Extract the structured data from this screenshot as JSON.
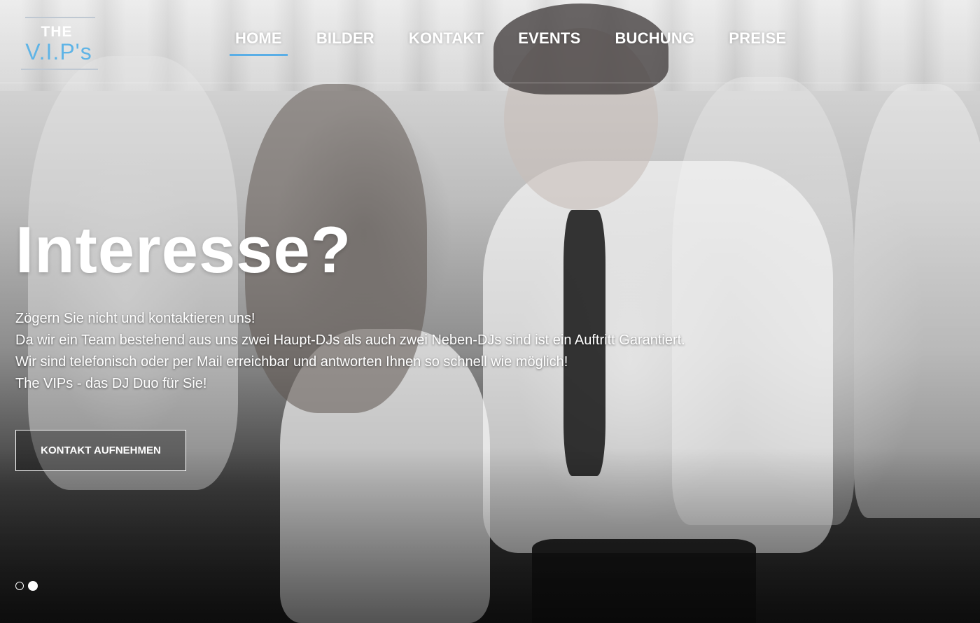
{
  "logo": {
    "line1": "THE",
    "line2": "V.I.P's",
    "accent_color": "#5fb4e6"
  },
  "nav": {
    "items": [
      {
        "label": "HOME",
        "active": true
      },
      {
        "label": "BILDER",
        "active": false
      },
      {
        "label": "KONTAKT",
        "active": false
      },
      {
        "label": "EVENTS",
        "active": false
      },
      {
        "label": "BUCHUNG",
        "active": false
      },
      {
        "label": "PREISE",
        "active": false
      }
    ],
    "active_underline_color": "#5aaee6"
  },
  "hero": {
    "headline": "Interesse?",
    "lines": [
      "Zögern Sie nicht und kontaktieren uns!",
      "Da wir ein Team bestehend aus uns zwei Haupt-DJs als auch zwei Neben-DJs sind ist ein Auftritt Garantiert.",
      "Wir sind telefonisch oder per Mail erreichbar und antworten Ihnen so schnell wie möglich!",
      "The VIPs - das DJ Duo für Sie!"
    ],
    "cta_label": "KONTAKT AUFNEHMEN"
  },
  "slider": {
    "slide_count": 2,
    "active_index": 1
  }
}
